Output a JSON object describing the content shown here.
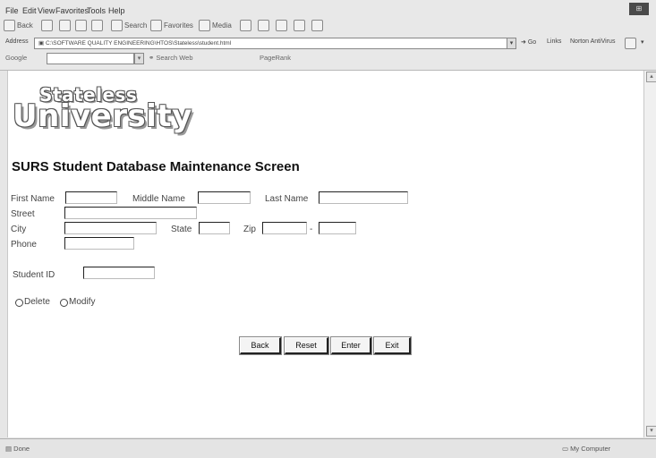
{
  "browser": {
    "menu": [
      "File",
      "Edit",
      "View",
      "Favorites",
      "Tools",
      "Help"
    ],
    "toolbar": {
      "back": "Back",
      "search": "Search",
      "favorites": "Favorites",
      "media": "Media"
    },
    "address": {
      "label": "Address",
      "value": "C:\\SOFTWARE QUALITY ENGINEERING\\HTOS\\Stateless\\student.html",
      "go": "Go",
      "links": "Links",
      "norton": "Norton AntiVirus"
    },
    "googlebar": {
      "label": "Google",
      "search_web": "Search Web",
      "popups": "PageRank"
    },
    "status": {
      "left": "Done",
      "right": "My Computer"
    }
  },
  "logo": {
    "line1": "Stateless",
    "line2": "University"
  },
  "form": {
    "title": "SURS Student Database Maintenance Screen",
    "labels": {
      "first_name": "First Name",
      "middle_name": "Middle Name",
      "last_name": "Last Name",
      "street": "Street",
      "city": "City",
      "state": "State",
      "zip": "Zip",
      "zip_sep": "-",
      "phone": "Phone",
      "student_id": "Student ID"
    },
    "radios": {
      "delete": "Delete",
      "modify": "Modify"
    },
    "buttons": {
      "back": "Back",
      "reset": "Reset",
      "enter": "Enter",
      "exit": "Exit"
    }
  }
}
